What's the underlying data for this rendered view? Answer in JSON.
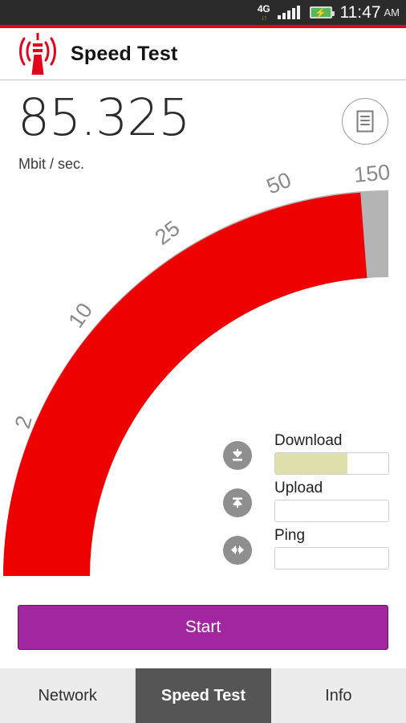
{
  "statusbar": {
    "network_type": "4G",
    "network_arrows": "↓↑",
    "time": "11:47",
    "ampm": "AM",
    "signal_icon": "signal-bars-icon",
    "battery_icon": "battery-charging-icon"
  },
  "header": {
    "title": "Speed Test",
    "logo_icon": "radio-tower-icon"
  },
  "readout": {
    "value": "85.325",
    "unit": "Mbit / sec.",
    "report_icon": "document-list-icon"
  },
  "gauge": {
    "ticks": [
      "2",
      "10",
      "25",
      "50",
      "150"
    ],
    "active_color": "#ee0000",
    "track_color": "#b4b4b4",
    "min": 2,
    "max": 150,
    "current": 85.325
  },
  "metrics": [
    {
      "label": "Download",
      "icon": "download-arrow-icon",
      "value": "",
      "progress": 64,
      "fill_color": "#dfe0ac"
    },
    {
      "label": "Upload",
      "icon": "upload-arrow-icon",
      "value": "",
      "progress": 0,
      "fill_color": "#dfe0ac"
    },
    {
      "label": "Ping",
      "icon": "ping-arrows-icon",
      "value": "",
      "progress": 0,
      "fill_color": "#dfe0ac"
    }
  ],
  "actions": {
    "start_label": "Start",
    "start_color": "#a1269f"
  },
  "tabs": [
    {
      "label": "Network",
      "active": false
    },
    {
      "label": "Speed Test",
      "active": true
    },
    {
      "label": "Info",
      "active": false
    }
  ]
}
